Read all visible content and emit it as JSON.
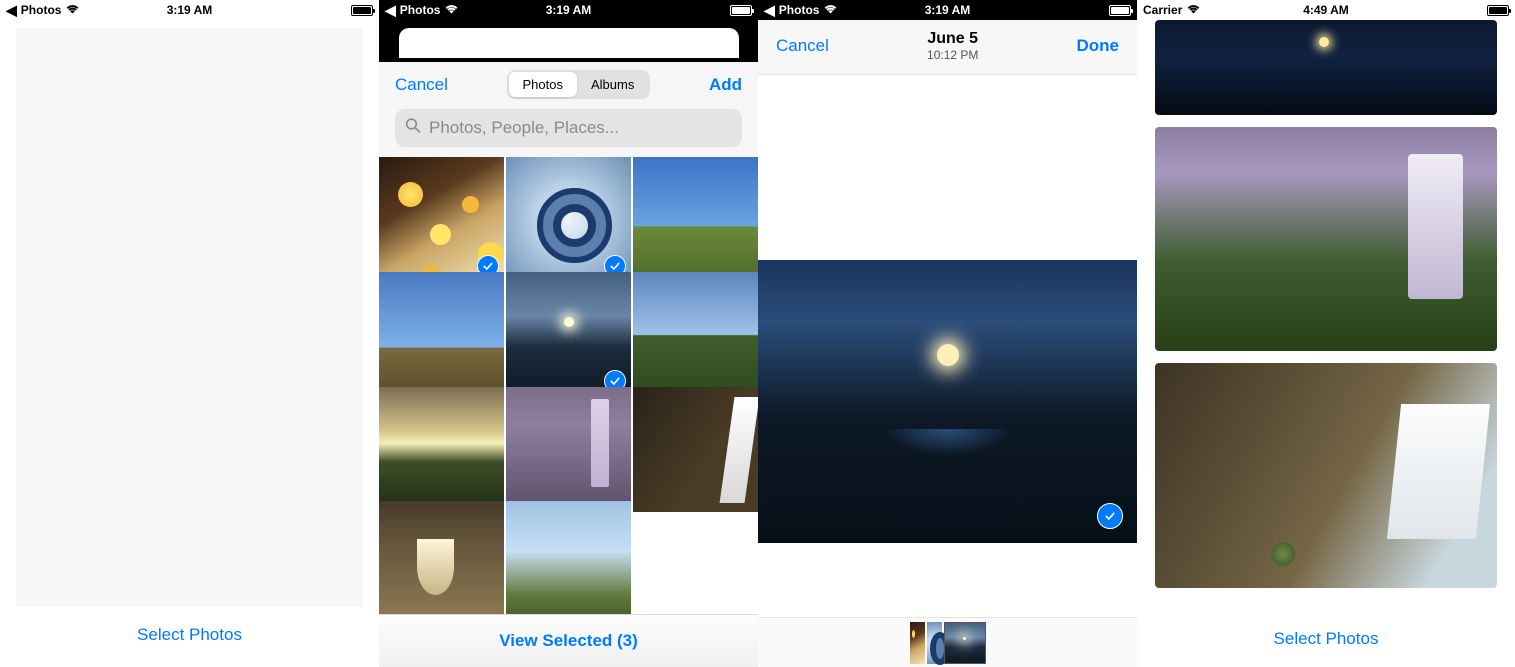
{
  "panel1": {
    "status": {
      "back_label": "Photos",
      "time": "3:19 AM"
    },
    "footer_button": "Select Photos"
  },
  "panel2": {
    "status": {
      "back_label": "Photos",
      "time": "3:19 AM"
    },
    "header": {
      "cancel": "Cancel",
      "add": "Add"
    },
    "segments": {
      "photos": "Photos",
      "albums": "Albums",
      "active": "photos"
    },
    "search_placeholder": "Photos, People, Places...",
    "grid_items": [
      {
        "kind": "art-lanterns",
        "selected": true
      },
      {
        "kind": "art-spiral",
        "selected": true
      },
      {
        "kind": "landscape-path-1",
        "selected": false
      },
      {
        "kind": "landscape-path-2",
        "selected": false
      },
      {
        "kind": "river-dusk",
        "selected": true
      },
      {
        "kind": "green-field",
        "selected": false
      },
      {
        "kind": "sunset-field",
        "selected": false
      },
      {
        "kind": "waterfall-purple",
        "selected": false
      },
      {
        "kind": "waterfall-gorge",
        "selected": false
      },
      {
        "kind": "rock-falls",
        "selected": false
      },
      {
        "kind": "dune-grass",
        "selected": false
      }
    ],
    "footer_label": "View Selected (3)",
    "selected_count": 3
  },
  "panel3": {
    "status": {
      "back_label": "Photos",
      "time": "3:19 AM"
    },
    "nav": {
      "cancel": "Cancel",
      "done": "Done",
      "title": "June 5",
      "subtitle": "10:12 PM"
    },
    "detail_selected": true,
    "strip": [
      {
        "kind": "art-lanterns",
        "active": false
      },
      {
        "kind": "art-spiral",
        "active": false
      },
      {
        "kind": "river-dusk",
        "active": true
      }
    ]
  },
  "panel4": {
    "status": {
      "carrier": "Carrier",
      "time": "4:49 AM"
    },
    "images": [
      {
        "kind": "river-dark"
      },
      {
        "kind": "waterfall-cliff"
      },
      {
        "kind": "waterfall-wide"
      }
    ],
    "footer_button": "Select Photos"
  }
}
